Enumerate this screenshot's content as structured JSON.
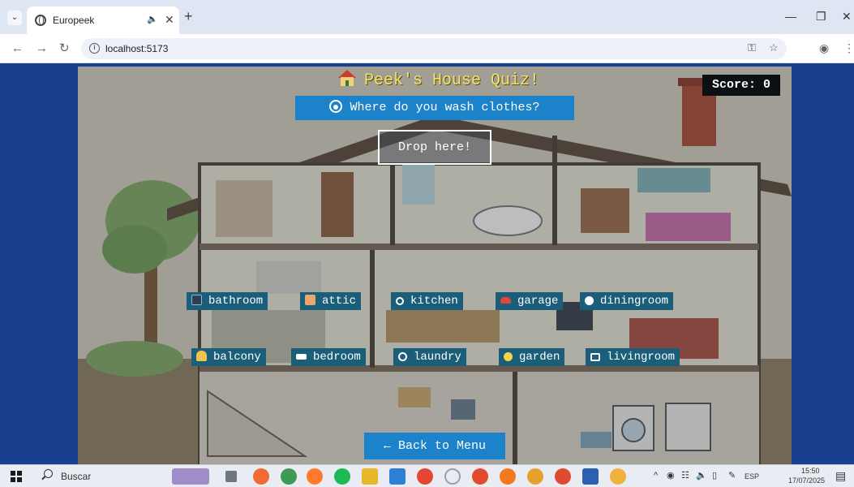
{
  "browser": {
    "tab_title": "Europeek",
    "url": "localhost:5173",
    "tab_menu_icon": "chevron-down-icon",
    "audio_icon": "speaker-icon"
  },
  "quiz": {
    "title": "Peek's House Quiz!",
    "score_label": "Score: 0",
    "question": "Where do you wash clothes?",
    "dropzone_label": "Drop here!",
    "back_label": "Back to Menu",
    "rooms_row1": [
      {
        "label": "bathroom",
        "icon": "toothbrush-icon",
        "color": "#2b3e57"
      },
      {
        "label": "attic",
        "icon": "box-icon",
        "color": "#e8a86a"
      },
      {
        "label": "kitchen",
        "icon": "magnifier-icon",
        "color": "#ffffff"
      },
      {
        "label": "garage",
        "icon": "car-icon",
        "color": "#e0483c"
      },
      {
        "label": "diningroom",
        "icon": "plate-icon",
        "color": "#ffffff"
      }
    ],
    "rooms_row2": [
      {
        "label": "balcony",
        "icon": "person-icon",
        "color": "#f2c14e"
      },
      {
        "label": "bedroom",
        "icon": "bed-icon",
        "color": "#ffffff"
      },
      {
        "label": "laundry",
        "icon": "washer-icon",
        "color": "#ffffff"
      },
      {
        "label": "garden",
        "icon": "flower-icon",
        "color": "#f6d34a"
      },
      {
        "label": "livingroom",
        "icon": "tv-icon",
        "color": "#ffffff"
      }
    ]
  },
  "taskbar": {
    "search_label": "Buscar",
    "language": "ESP",
    "time": "15:50",
    "date": "17/07/2025"
  },
  "colors": {
    "page_bg": "#1a3f8f",
    "button_blue": "#1c82c9",
    "chip_teal": "#1a5e7a",
    "title_yellow": "#f3e36b"
  }
}
